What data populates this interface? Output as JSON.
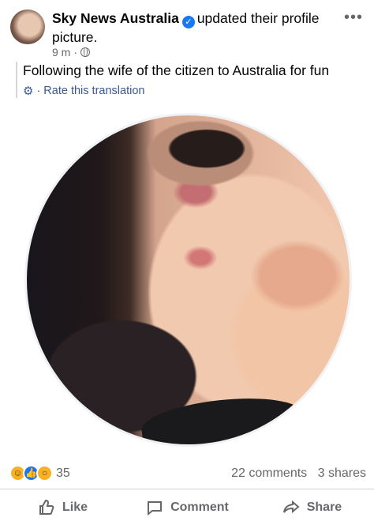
{
  "post": {
    "author": "Sky News Australia",
    "action_text": "updated their profile picture.",
    "time": "9 m",
    "content": "Following the wife of the citizen to Australia for fun",
    "translation_link": "Rate this translation"
  },
  "icons": {
    "verified": "verified-badge-icon",
    "privacy": "globe-icon",
    "more": "more-icon",
    "translation": "gear-icon",
    "reactions": [
      "laugh-reaction-icon",
      "like-reaction-icon",
      "wow-reaction-icon"
    ],
    "like": "thumbs-up-icon",
    "comment": "comment-bubble-icon",
    "share": "share-arrow-icon"
  },
  "engagement": {
    "reactions_count": "35",
    "comments": "22 comments",
    "shares": "3 shares"
  },
  "actions": {
    "like": "Like",
    "comment": "Comment",
    "share": "Share"
  },
  "colors": {
    "facebook_blue": "#1877f2",
    "link_blue": "#385898",
    "secondary_text": "#65676b"
  }
}
